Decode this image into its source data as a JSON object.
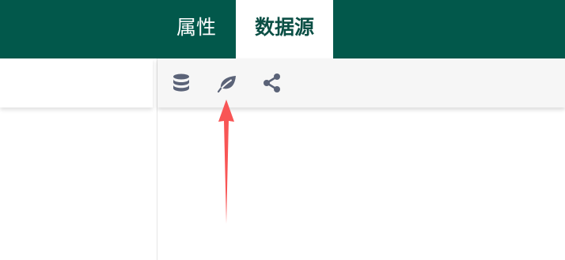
{
  "header": {
    "tabs": [
      {
        "label": "属性",
        "active": false
      },
      {
        "label": "数据源",
        "active": true
      }
    ]
  },
  "toolbar": {
    "icons": [
      "database-icon",
      "leaf-icon",
      "share-icon"
    ]
  },
  "colors": {
    "header_bg": "#02584b",
    "active_tab_text": "#0b4f45",
    "icon": "#5b6378",
    "annotation_arrow": "#f85555"
  }
}
